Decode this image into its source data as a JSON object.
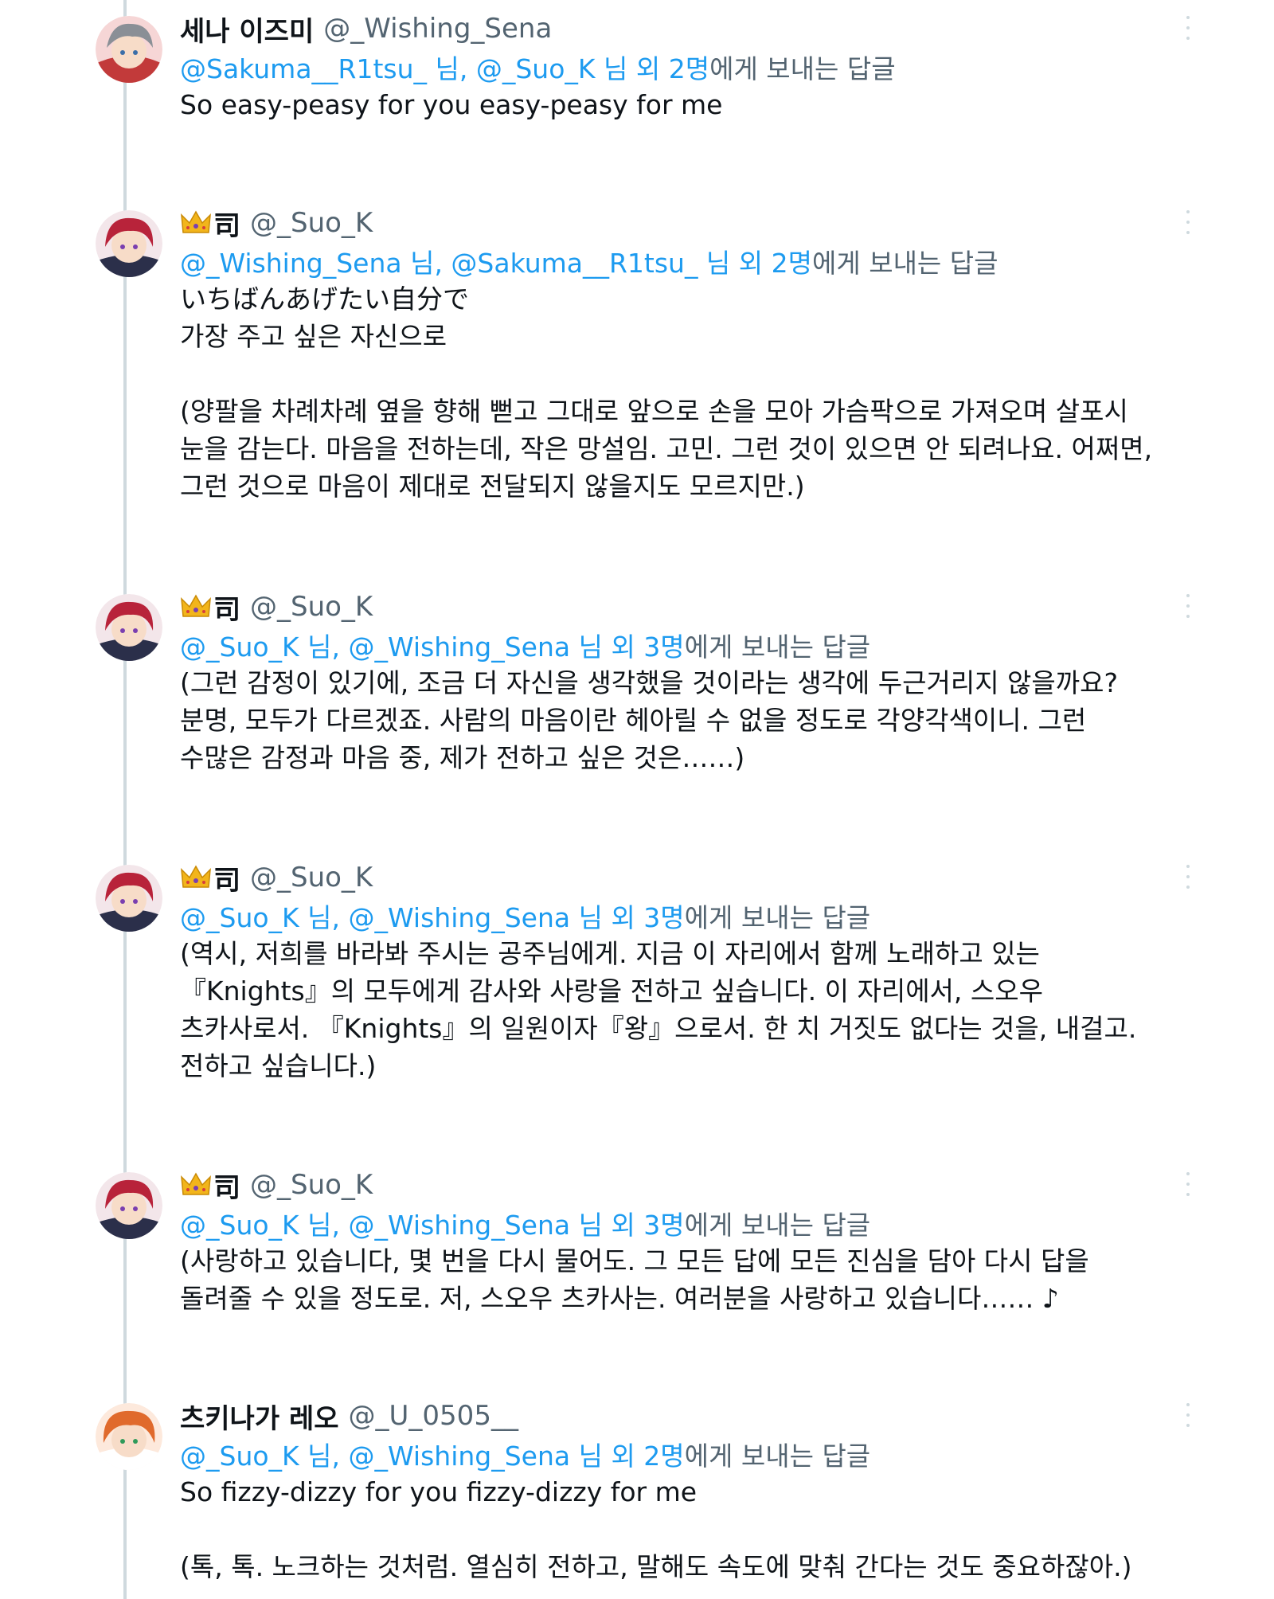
{
  "tweets": [
    {
      "display_name": "세나 이즈미",
      "crown": false,
      "handle": "@_Wishing_Sena",
      "reply_to_mentions": "@Sakuma__R1tsu_ 님, @_Suo_K 님 외 2명",
      "reply_to_suffix": "에게 보내는 답글",
      "text": "So easy-peasy for you easy-peasy for me"
    },
    {
      "display_name": "司",
      "crown": true,
      "handle": "@_Suo_K",
      "reply_to_mentions": "@_Wishing_Sena 님, @Sakuma__R1tsu_ 님 외 2명",
      "reply_to_suffix": "에게 보내는 답글",
      "text": "いちばんあげたい自分で\n가장 주고 싶은 자신으로\n\n(양팔을 차례차례 옆을 향해 뻗고 그대로 앞으로 손을 모아 가슴팍으로 가져오며 살포시\n눈을 감는다. 마음을 전하는데, 작은 망설임. 고민. 그런 것이 있으면 안 되려나요. 어쩌면,\n그런 것으로 마음이 제대로 전달되지 않을지도 모르지만.)"
    },
    {
      "display_name": "司",
      "crown": true,
      "handle": "@_Suo_K",
      "reply_to_mentions": "@_Suo_K 님, @_Wishing_Sena 님 외 3명",
      "reply_to_suffix": "에게 보내는 답글",
      "text": "(그런 감정이 있기에, 조금 더 자신을 생각했을 것이라는 생각에 두근거리지 않을까요?\n분명, 모두가 다르겠죠. 사람의 마음이란 헤아릴 수 없을 정도로 각양각색이니. 그런\n수많은 감정과 마음 중, 제가 전하고 싶은 것은……)"
    },
    {
      "display_name": "司",
      "crown": true,
      "handle": "@_Suo_K",
      "reply_to_mentions": "@_Suo_K 님, @_Wishing_Sena 님 외 3명",
      "reply_to_suffix": "에게 보내는 답글",
      "text": "(역시, 저희를 바라봐 주시는 공주님에게. 지금 이 자리에서 함께 노래하고 있는\n『Knights』의 모두에게 감사와 사랑을 전하고 싶습니다. 이 자리에서, 스오우\n츠카사로서. 『Knights』의 일원이자『왕』으로서. 한 치 거짓도 없다는 것을, 내걸고.\n전하고 싶습니다.)"
    },
    {
      "display_name": "司",
      "crown": true,
      "handle": "@_Suo_K",
      "reply_to_mentions": "@_Suo_K 님, @_Wishing_Sena 님 외 3명",
      "reply_to_suffix": "에게 보내는 답글",
      "text": "(사랑하고 있습니다, 몇 번을 다시 물어도. 그 모든 답에 모든 진심을 담아 다시 답을\n돌려줄 수 있을 정도로. 저, 스오우 츠카사는. 여러분을 사랑하고 있습니다…… ♪"
    },
    {
      "display_name": "츠키나가 레오",
      "crown": false,
      "handle": "@_U_0505__",
      "reply_to_mentions": "@_Suo_K 님, @_Wishing_Sena 님 외 2명",
      "reply_to_suffix": "에게 보내는 답글",
      "text": "So fizzy-dizzy for you fizzy-dizzy for me\n\n(톡, 톡. 노크하는 것처럼. 열심히 전하고, 말해도 속도에 맞춰 간다는 것도 중요하잖아.)"
    }
  ],
  "colors": {
    "mention": "#1d9bf0",
    "secondary": "#536471",
    "text": "#0f1419",
    "thread_line": "#cfd9de"
  }
}
